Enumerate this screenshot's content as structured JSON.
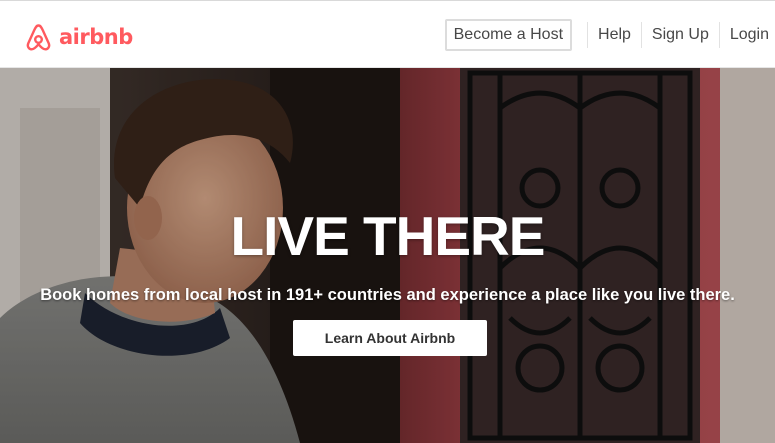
{
  "brand": {
    "name": "airbnb",
    "color": "#ff5a5f",
    "logo_icon": "airbnb-belo-icon"
  },
  "nav": {
    "become_host": "Become a Host",
    "help": "Help",
    "sign_up": "Sign Up",
    "login": "Login"
  },
  "hero": {
    "title": "LIVE THERE",
    "subtitle": "Book homes from local host in 191+ countries and experience a place like you live there.",
    "cta_label": "Learn About Airbnb",
    "background_colors": {
      "door": "#a8444a",
      "wall": "#d7ccc4",
      "shadow": "#2b2320"
    }
  }
}
